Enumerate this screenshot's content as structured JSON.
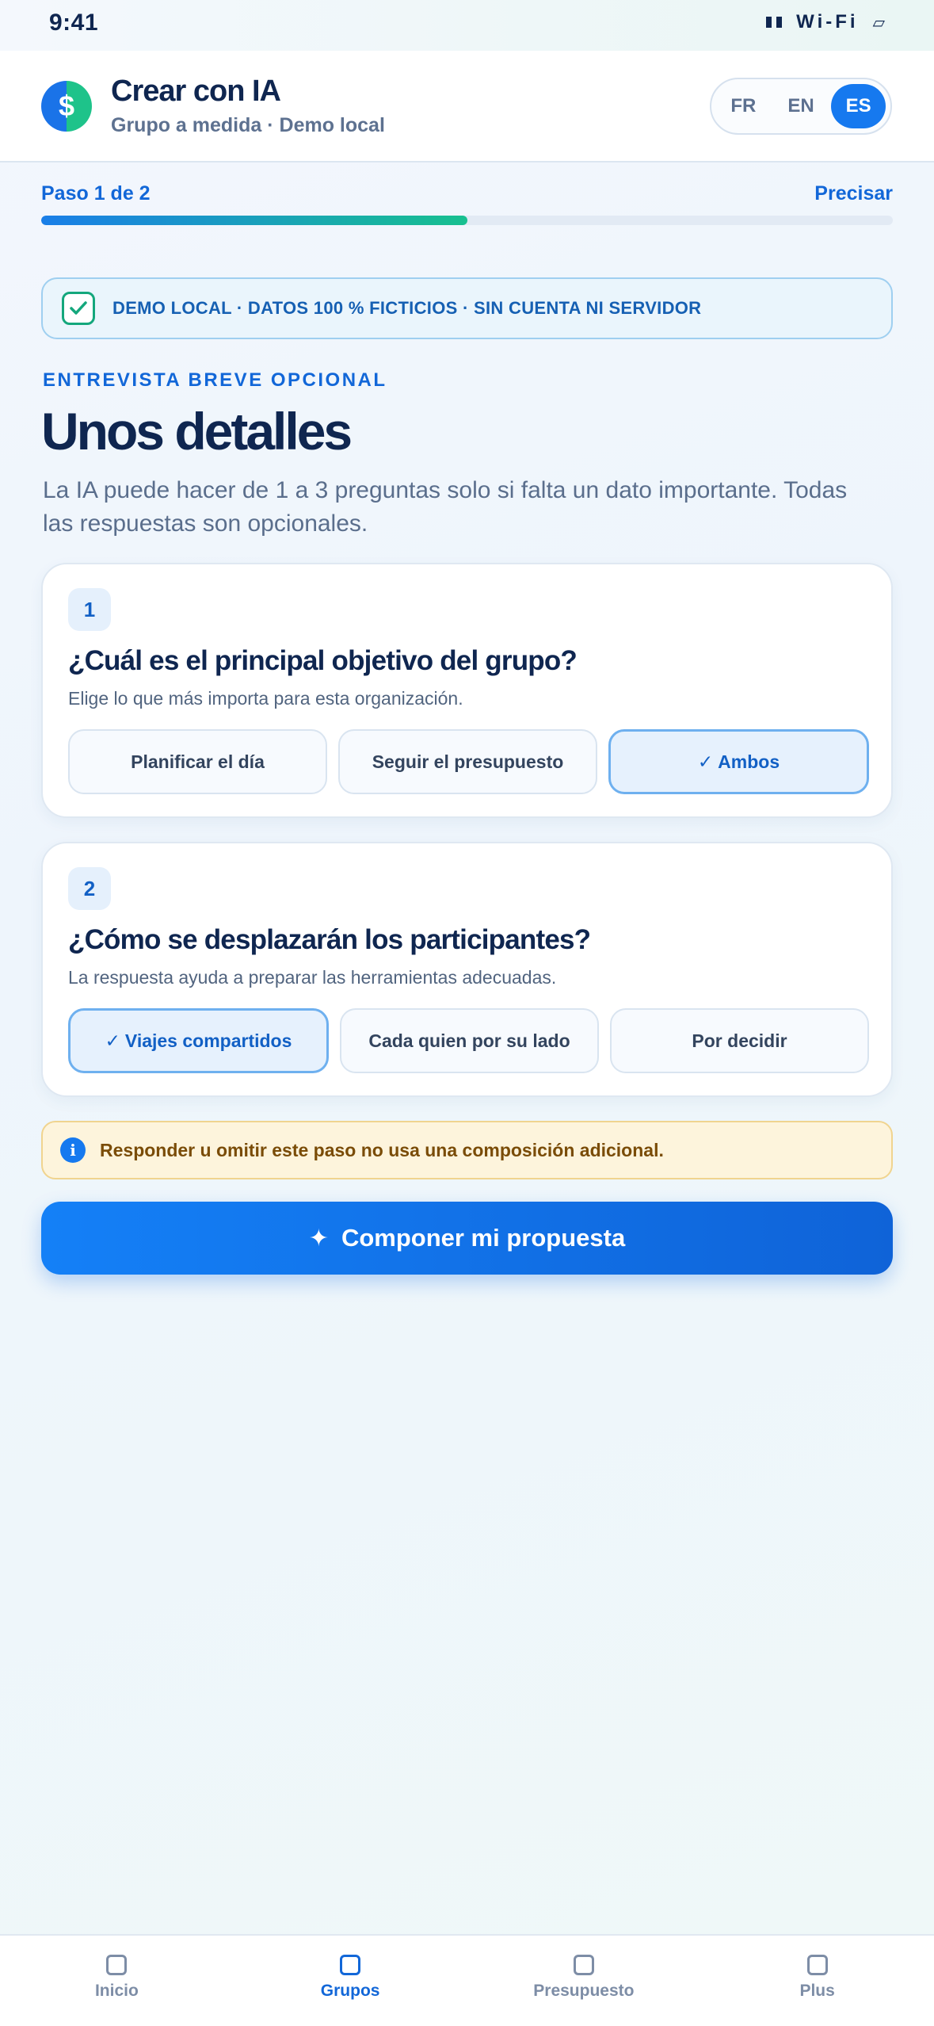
{
  "status_bar": {
    "time": "9:41",
    "wifi": "Wi-Fi",
    "battery": "▱"
  },
  "header": {
    "logo_glyph": "$",
    "title": "Crear con IA",
    "subtitle": "Grupo a medida · Demo local",
    "languages": [
      {
        "label": "FR",
        "active": false
      },
      {
        "label": "EN",
        "active": false
      },
      {
        "label": "ES",
        "active": true
      }
    ]
  },
  "progress": {
    "step_label": "Paso 1 de 2",
    "right_action": "Precisar",
    "fraction": 0.5
  },
  "demo_banner": {
    "icon": "check-square-icon",
    "text": "DEMO LOCAL · DATOS 100 % FICTICIOS · SIN CUENTA NI SERVIDOR"
  },
  "intro": {
    "eyebrow": "ENTREVISTA BREVE OPCIONAL",
    "title": "Unos detalles",
    "description": "La IA puede hacer de 1 a 3 preguntas solo si falta un dato importante. Todas las respuestas son opcionales."
  },
  "questions": [
    {
      "number": "1",
      "title": "¿Cuál es el principal objetivo del grupo?",
      "help": "Elige lo que más importa para esta organización.",
      "options": [
        {
          "label": "Planificar el día",
          "selected": false
        },
        {
          "label": "Seguir el presupuesto",
          "selected": false
        },
        {
          "label": "Ambos",
          "selected": true
        }
      ]
    },
    {
      "number": "2",
      "title": "¿Cómo se desplazarán los participantes?",
      "help": "La respuesta ayuda a preparar las herramientas adecuadas.",
      "options": [
        {
          "label": "Viajes compartidos",
          "selected": true
        },
        {
          "label": "Cada quien por su lado",
          "selected": false
        },
        {
          "label": "Por decidir",
          "selected": false
        }
      ]
    }
  ],
  "info": {
    "icon": "info-icon",
    "glyph": "i",
    "text": "Responder u omitir este paso no usa una composición adicional."
  },
  "cta": {
    "icon": "sparkle-icon",
    "glyph": "✦",
    "label": "Componer mi propuesta"
  },
  "bottom_nav": [
    {
      "label": "Inicio",
      "active": false
    },
    {
      "label": "Grupos",
      "active": true
    },
    {
      "label": "Presupuesto",
      "active": false
    },
    {
      "label": "Plus",
      "active": false
    }
  ],
  "colors": {
    "accent": "#1679ef",
    "progress_end": "#18c08f",
    "info_bg": "#fdf4dc",
    "selected_border": "#6eb0ef"
  }
}
